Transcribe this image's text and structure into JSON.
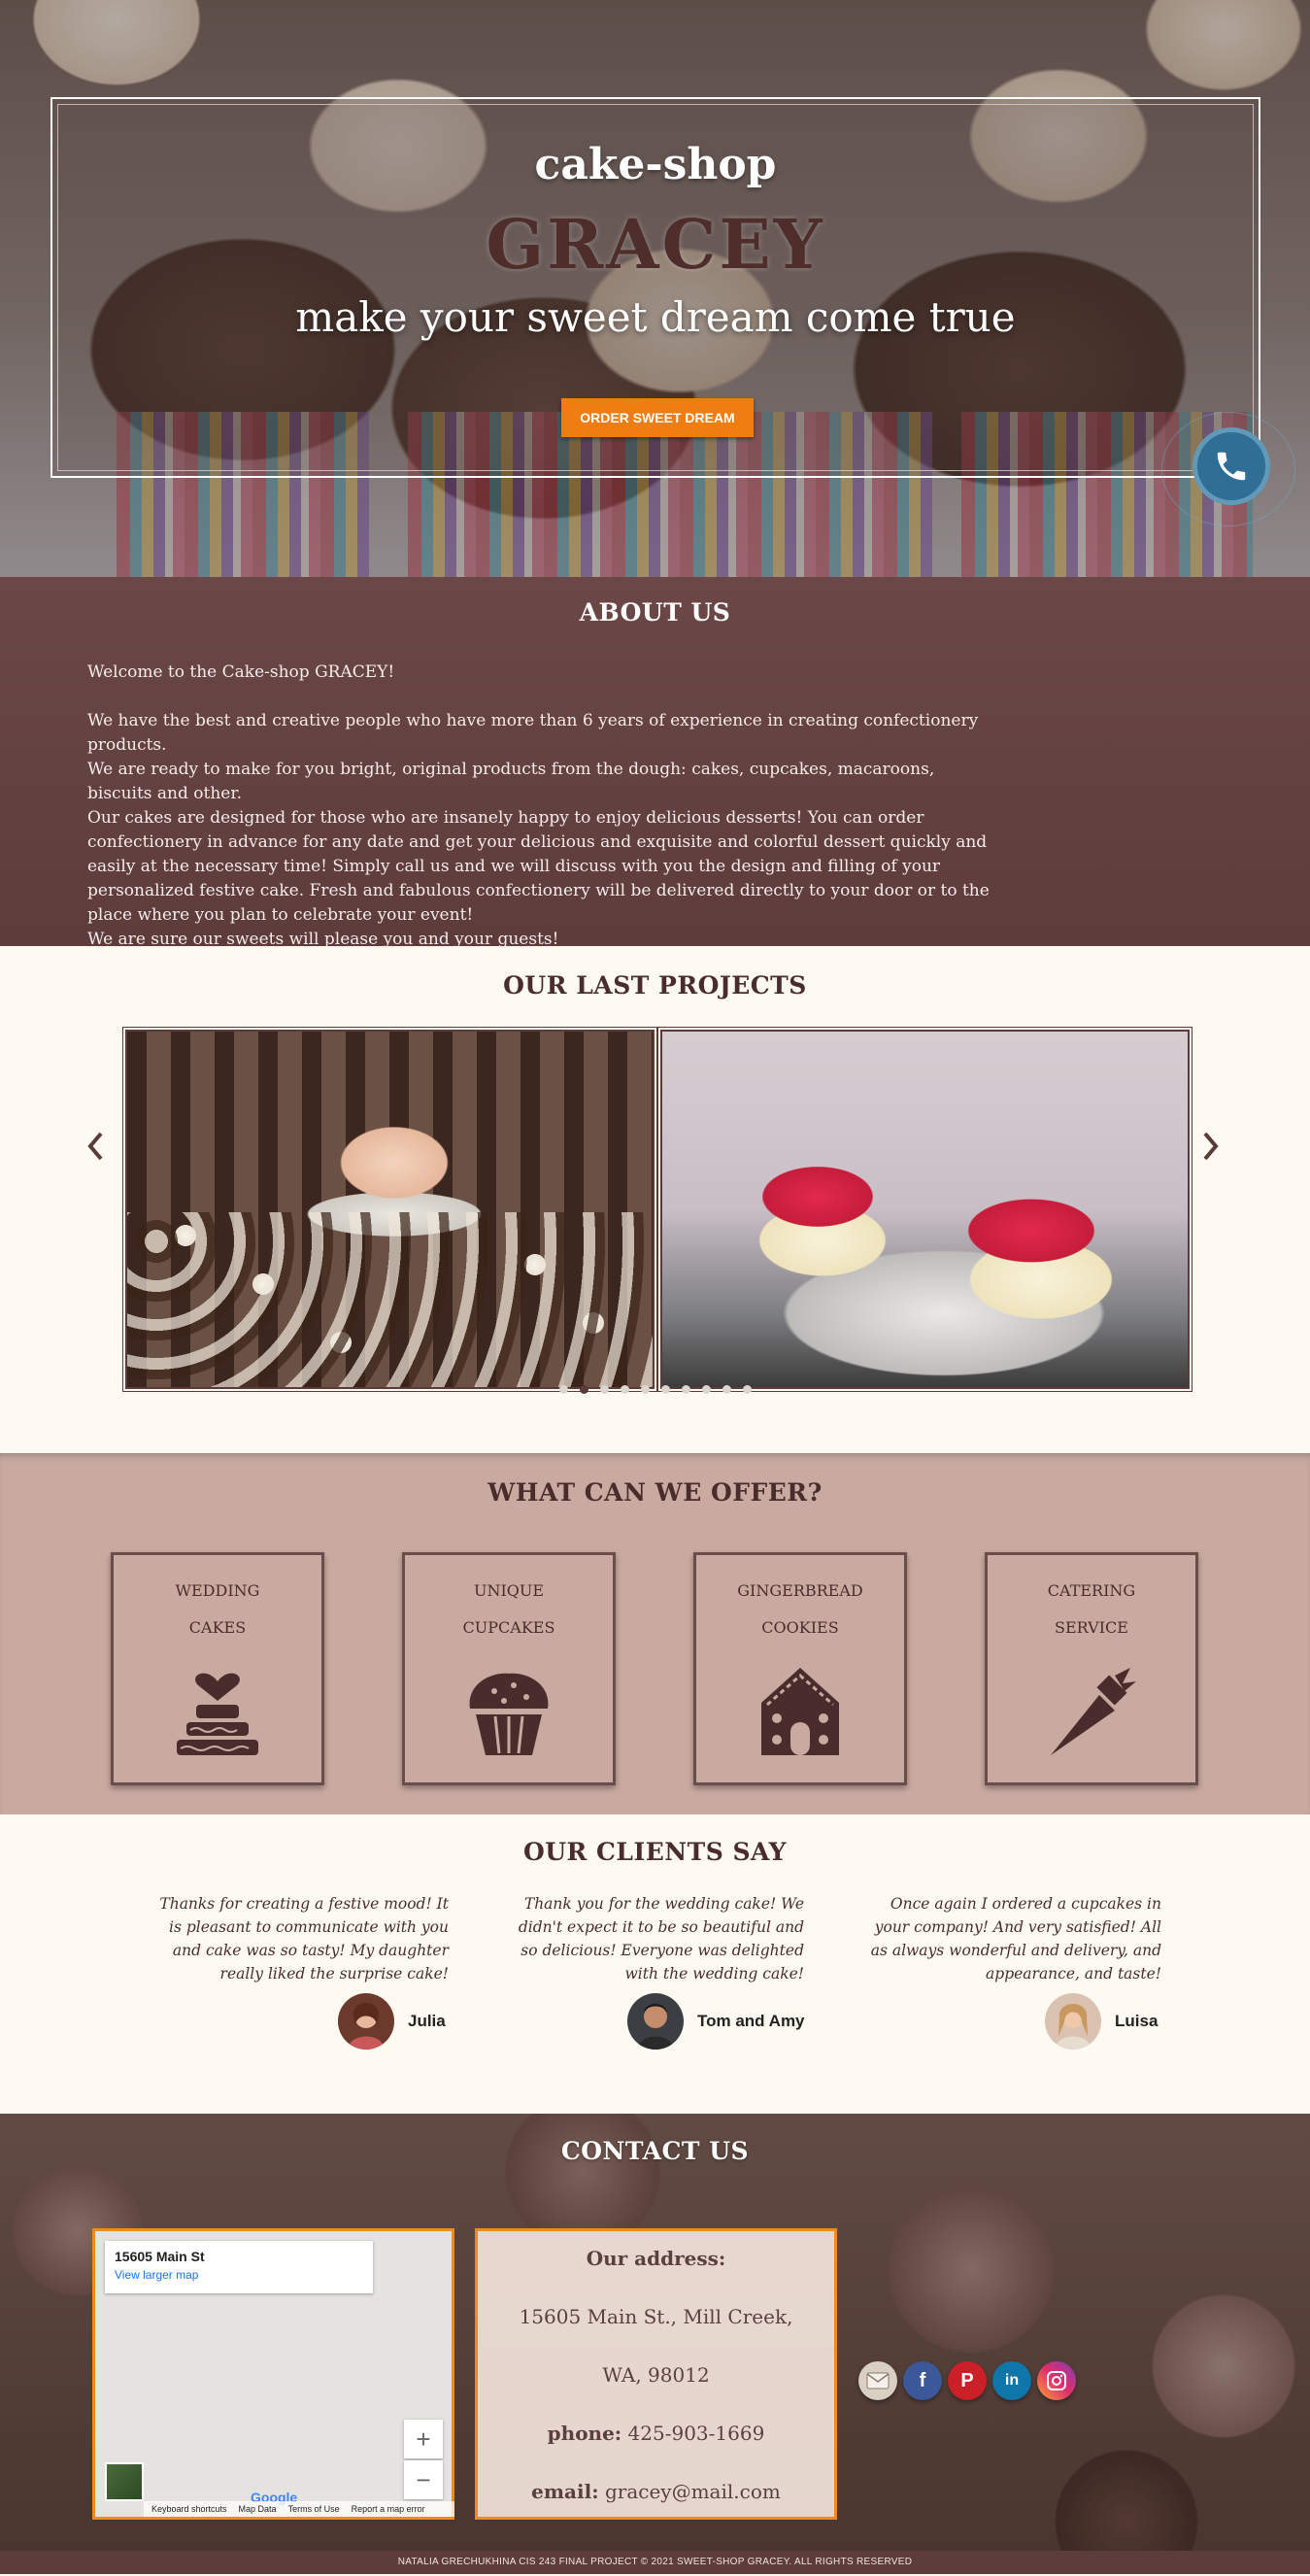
{
  "hero": {
    "subtitle": "cake-shop",
    "title": "GRACEY",
    "tagline": "make your sweet dream come true",
    "order_button": "ORDER SWEET DREAM"
  },
  "about": {
    "title": "ABOUT US",
    "welcome": "Welcome to the Cake-shop GRACEY!",
    "lines": [
      "We have the best and creative people who have more than 6 years of experience in creating confectionery products.",
      "We are ready to make for you bright, original products from the dough: cakes, cupcakes, macaroons, biscuits and other.",
      "Our cakes are designed for those who are insanely happy to enjoy delicious desserts! You can order confectionery in advance for any date and get your delicious and exquisite and colorful dessert quickly and easily at the necessary time! Simply call us and we will discuss with you the design and filling of your personalized festive cake. Fresh and fabulous confectionery will be delivered directly to your door or to the place where you plan to celebrate your event!",
      "We are sure our sweets will please you and your guests!"
    ]
  },
  "projects": {
    "title": "OUR LAST PROJECTS",
    "dot_count": 10,
    "active_dot": 2
  },
  "offer": {
    "title": "WHAT CAN WE OFFER?",
    "cards": [
      {
        "label": "WEDDING\nCAKES",
        "icon": "wedding-cake-icon"
      },
      {
        "label": "UNIQUE\nCUPCAKES",
        "icon": "cupcake-icon"
      },
      {
        "label": "GINGERBREAD\nCOOKIES",
        "icon": "gingerbread-house-icon"
      },
      {
        "label": "CATERING\nSERVICE",
        "icon": "piping-bag-icon"
      }
    ]
  },
  "clients": {
    "title": "OUR CLIENTS SAY",
    "reviews": [
      {
        "text": "Thanks for creating a festive mood! It is pleasant to communicate with you and cake was so tasty! My daughter really liked the surprise cake!",
        "name": "Julia"
      },
      {
        "text": "Thank you for the wedding cake! We didn't expect it to be so beautiful and so delicious! Everyone was delighted with the wedding cake!",
        "name": "Tom and Amy"
      },
      {
        "text": "Once again I ordered a cupcakes in your company! And very satisfied! All as always wonderful and delivery, and appearance, and taste!",
        "name": "Luisa"
      }
    ]
  },
  "contact": {
    "title": "CONTACT US",
    "map": {
      "address": "15605 Main St",
      "link": "View larger map",
      "logo": "Google",
      "zoom_in": "+",
      "zoom_out": "−",
      "footer": [
        "Keyboard shortcuts",
        "Map Data",
        "Terms of Use",
        "Report a map error"
      ]
    },
    "address_heading": "Our address:",
    "address_line1": "15605 Main St., Mill Creek,",
    "address_line2": "WA, 98012",
    "phone_label": "phone:",
    "phone": "425-903-1669",
    "email_label": "email:",
    "email": "gracey@mail.com",
    "socials": [
      "email-icon",
      "facebook-icon",
      "pinterest-icon",
      "linkedin-icon",
      "instagram-icon"
    ]
  },
  "footer": {
    "text": "NATALIA GRECHUKHINA CIS 243 FINAL PROJECT © 2021 SWEET-SHOP GRACEY.   ALL RIGHTS RESERVED"
  },
  "colors": {
    "accent": "#f07d10",
    "brown": "#5d3c3b",
    "offer_bg": "#c9aaa0",
    "cream": "#fefaf1",
    "phone": "#2f6e95"
  }
}
